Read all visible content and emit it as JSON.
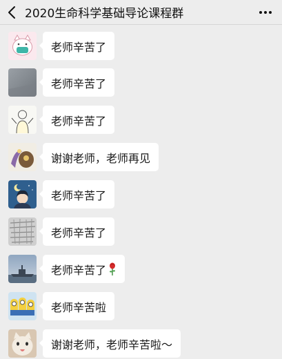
{
  "header": {
    "title": "2020生命科学基础导论课程群"
  },
  "messages": [
    {
      "text": "老师辛苦了",
      "avatar_icon": "cartoon-cat-mask-icon"
    },
    {
      "text": "老师辛苦了",
      "avatar_icon": "gray-photo-icon"
    },
    {
      "text": "老师辛苦了",
      "avatar_icon": "sketch-figure-icon"
    },
    {
      "text": "谢谢老师，老师再见",
      "avatar_icon": "cartoon-animals-icon"
    },
    {
      "text": "老师辛苦了",
      "avatar_icon": "night-sky-boy-icon"
    },
    {
      "text": "老师辛苦了",
      "avatar_icon": "mono-drawing-icon"
    },
    {
      "text": "老师辛苦了",
      "avatar_icon": "warship-icon",
      "emoji": "rose-icon"
    },
    {
      "text": "老师辛苦啦",
      "avatar_icon": "minions-icon"
    },
    {
      "text": "谢谢老师，老师辛苦啦～",
      "avatar_icon": "cat-icon"
    }
  ],
  "colors": {
    "background": "#ededed",
    "bubble": "#ffffff",
    "text": "#191919"
  }
}
